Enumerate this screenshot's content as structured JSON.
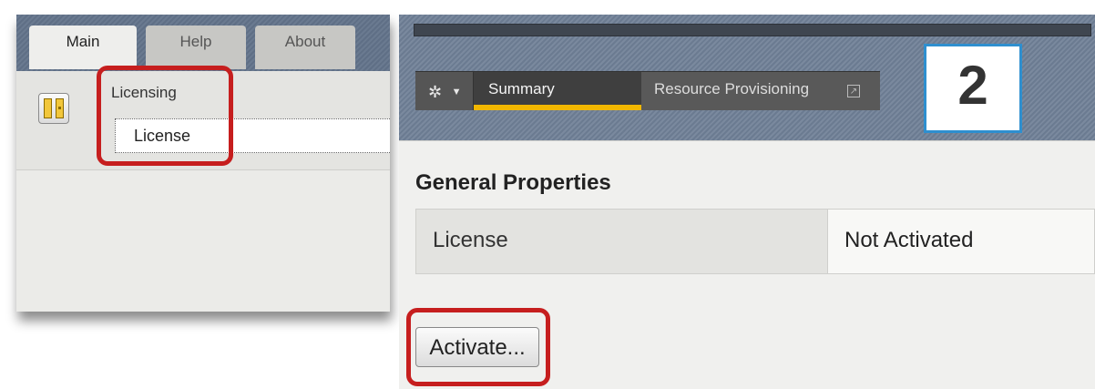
{
  "left_tabs": [
    "Main",
    "Help",
    "About"
  ],
  "left_nav": {
    "heading": "Licensing",
    "item": "License"
  },
  "toolbar": {
    "gear_icon": "gear-icon",
    "caret_icon": "chevron-down-icon",
    "summary_label": "Summary",
    "resource_label": "Resource Provisioning",
    "resource_icon": "external-link-icon"
  },
  "step_badge": "2",
  "content": {
    "section_title": "General Properties",
    "row_label": "License",
    "row_value": "Not Activated",
    "activate_button": "Activate..."
  },
  "colors": {
    "highlight_red": "#c61e1e",
    "accent_yellow": "#f2b700",
    "badge_blue": "#2e8fcf",
    "header_blue_gray": "#6b7b91"
  }
}
